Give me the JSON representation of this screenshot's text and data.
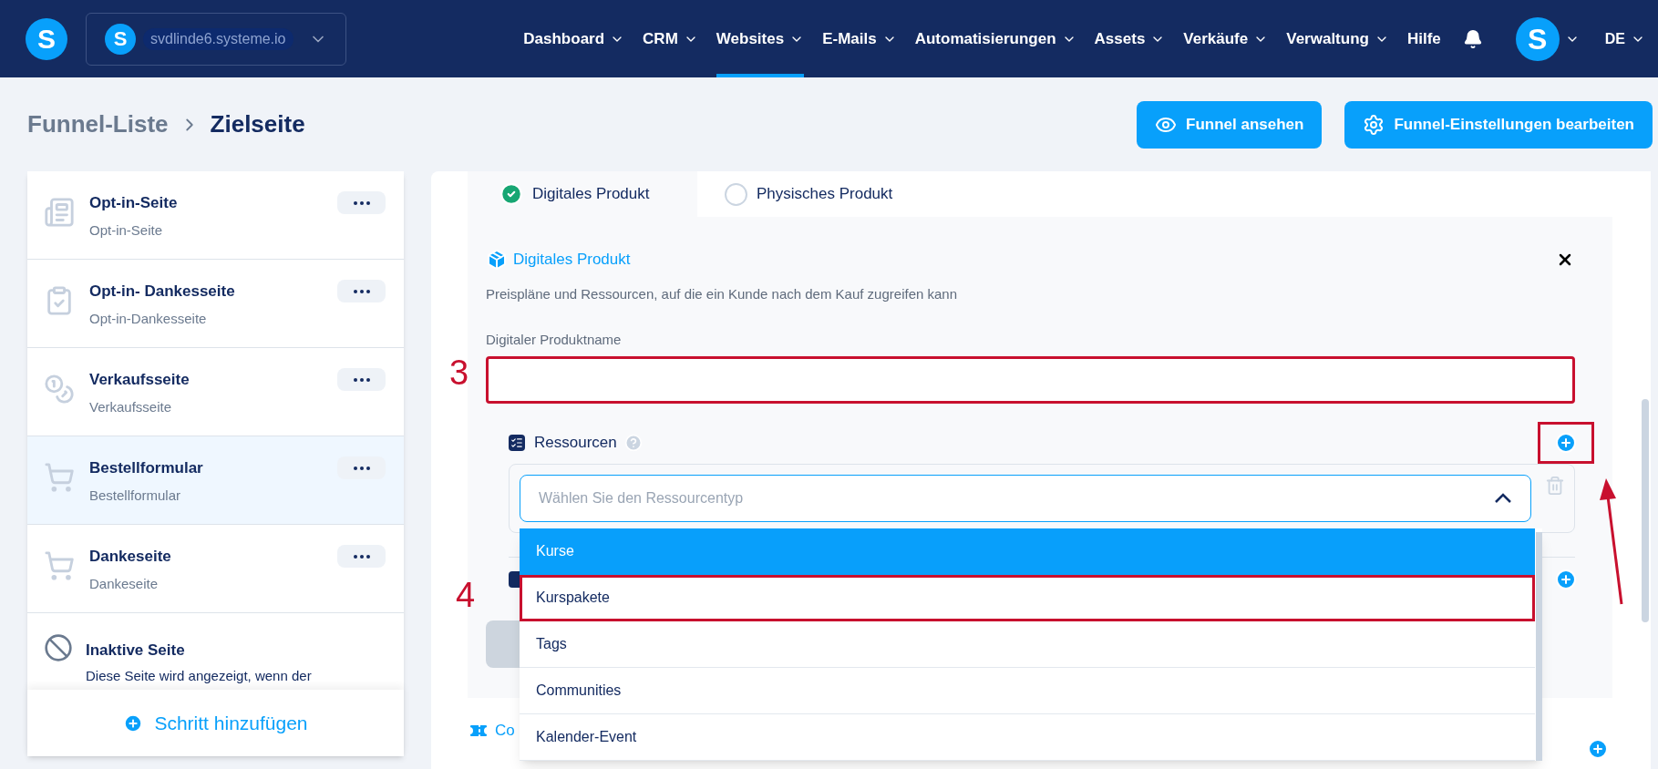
{
  "topbar": {
    "logo": "S",
    "site_avatar": "S",
    "site": "svdlinde6.systeme.io",
    "user_avatar": "S",
    "language": "DE",
    "nav": [
      {
        "label": "Dashboard",
        "selected": false,
        "dropdown": true
      },
      {
        "label": "CRM",
        "selected": false,
        "dropdown": true
      },
      {
        "label": "Websites",
        "selected": true,
        "dropdown": true
      },
      {
        "label": "E-Mails",
        "selected": false,
        "dropdown": true
      },
      {
        "label": "Automatisierungen",
        "selected": false,
        "dropdown": true
      },
      {
        "label": "Assets",
        "selected": false,
        "dropdown": true
      },
      {
        "label": "Verkäufe",
        "selected": false,
        "dropdown": true
      },
      {
        "label": "Verwaltung",
        "selected": false,
        "dropdown": true
      },
      {
        "label": "Hilfe",
        "selected": false,
        "dropdown": false
      }
    ]
  },
  "breadcrumb": [
    "Funnel-Liste",
    "Zielseite"
  ],
  "actions": [
    {
      "label": "Funnel ansehen",
      "kind": "view"
    },
    {
      "label": "Funnel-Einstellungen bearbeiten",
      "kind": "settings"
    }
  ],
  "steps": [
    {
      "title": "Opt-in-Seite",
      "subtitle": "Opt-in-Seite",
      "kind": "optin",
      "selected": false
    },
    {
      "title": "Opt-in- Dankesseite",
      "subtitle": "Opt-in-Dankesseite",
      "kind": "optin_thanks",
      "selected": false
    },
    {
      "title": "Verkaufsseite",
      "subtitle": "Verkaufsseite",
      "kind": "sales",
      "selected": false
    },
    {
      "title": "Bestellformular",
      "subtitle": "Bestellformular",
      "kind": "order",
      "selected": true
    },
    {
      "title": "Dankeseite",
      "subtitle": "Dankeseite",
      "kind": "thanks",
      "selected": false
    }
  ],
  "inactive": {
    "title": "Inaktive Seite",
    "description": "Diese Seite wird angezeigt, wenn der"
  },
  "add_step": "Schritt hinzufügen",
  "product_tabs": [
    {
      "label": "Digitales Produkt",
      "selected": true
    },
    {
      "label": "Physisches Produkt",
      "selected": false
    }
  ],
  "section": {
    "title": "Digitales Produkt",
    "description": "Preispläne und Ressourcen, auf die ein Kunde nach dem Kauf zugreifen kann",
    "name_label": "Digitaler Produktname",
    "name_annotation": "3"
  },
  "resources": {
    "title": "Ressourcen",
    "add_marked": true,
    "placeholder": "Wählen Sie den Ressourcentyp",
    "expanded": true,
    "options": [
      {
        "label": "Kurse",
        "selected": true,
        "marked": false
      },
      {
        "label": "Kurspakete",
        "selected": false,
        "marked": true,
        "annotation": "4"
      },
      {
        "label": "Tags",
        "selected": false,
        "marked": false
      },
      {
        "label": "Communities",
        "selected": false,
        "marked": false
      },
      {
        "label": "Kalender-Event",
        "selected": false,
        "marked": false
      }
    ]
  },
  "coupon": "Co"
}
